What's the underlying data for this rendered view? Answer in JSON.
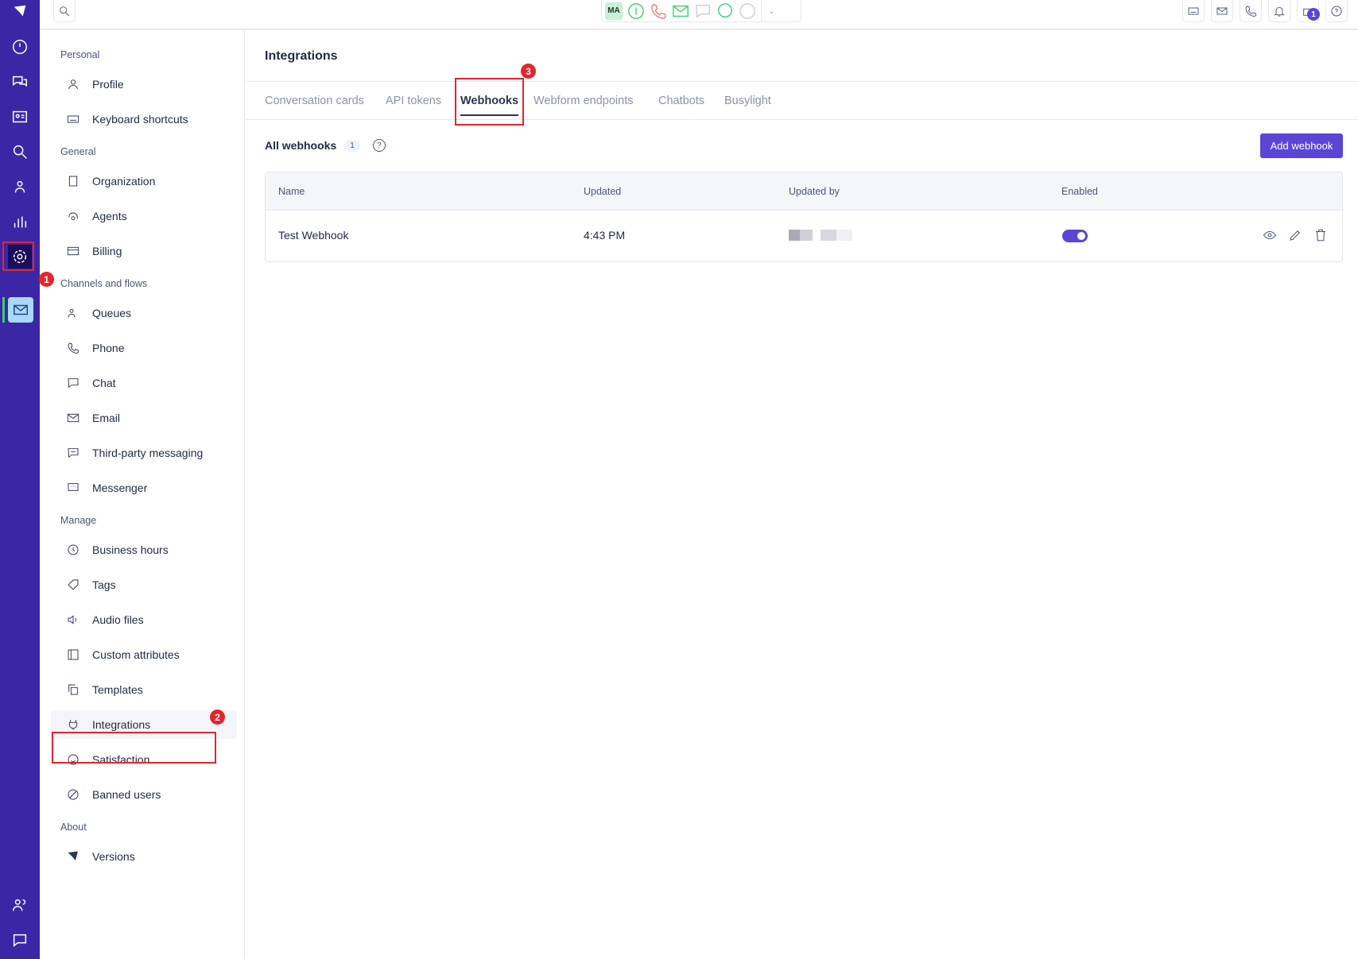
{
  "topbar": {
    "agent_initials": "MA",
    "notification_count": "1"
  },
  "sidebar": {
    "sections": [
      {
        "label": "Personal",
        "items": [
          {
            "label": "Profile",
            "icon": "user-icon"
          },
          {
            "label": "Keyboard shortcuts",
            "icon": "keyboard-icon"
          }
        ]
      },
      {
        "label": "General",
        "items": [
          {
            "label": "Organization",
            "icon": "building-icon"
          },
          {
            "label": "Agents",
            "icon": "headset-icon"
          },
          {
            "label": "Billing",
            "icon": "credit-card-icon"
          }
        ]
      },
      {
        "label": "Channels and flows",
        "items": [
          {
            "label": "Queues",
            "icon": "users-icon"
          },
          {
            "label": "Phone",
            "icon": "phone-icon"
          },
          {
            "label": "Chat",
            "icon": "chat-icon"
          },
          {
            "label": "Email",
            "icon": "mail-icon"
          },
          {
            "label": "Third-party messaging",
            "icon": "message-icon"
          },
          {
            "label": "Messenger",
            "icon": "messenger-icon"
          }
        ]
      },
      {
        "label": "Manage",
        "items": [
          {
            "label": "Business hours",
            "icon": "clock-icon"
          },
          {
            "label": "Tags",
            "icon": "tag-icon"
          },
          {
            "label": "Audio files",
            "icon": "speaker-icon"
          },
          {
            "label": "Custom attributes",
            "icon": "panel-icon"
          },
          {
            "label": "Templates",
            "icon": "copy-icon"
          },
          {
            "label": "Integrations",
            "icon": "plug-icon"
          },
          {
            "label": "Satisfaction",
            "icon": "smile-icon"
          },
          {
            "label": "Banned users",
            "icon": "ban-icon"
          }
        ]
      },
      {
        "label": "About",
        "items": [
          {
            "label": "Versions",
            "icon": "logo-icon"
          }
        ]
      }
    ]
  },
  "main": {
    "title": "Integrations",
    "tabs": [
      "Conversation cards",
      "API tokens",
      "Webhooks",
      "Webform endpoints",
      "Chatbots",
      "Busylight"
    ],
    "active_tab": "Webhooks",
    "list_title": "All webhooks",
    "count": "1",
    "help": "?",
    "add_button": "Add webhook",
    "columns": [
      "Name",
      "Updated",
      "Updated by",
      "Enabled"
    ],
    "rows": [
      {
        "name": "Test Webhook",
        "updated": "4:43 PM",
        "enabled": true
      }
    ]
  },
  "annotations": [
    "1",
    "2",
    "3"
  ],
  "colors": {
    "rail": "#3b27a6",
    "accent": "#5b45d8",
    "annotation": "#e5242e"
  }
}
